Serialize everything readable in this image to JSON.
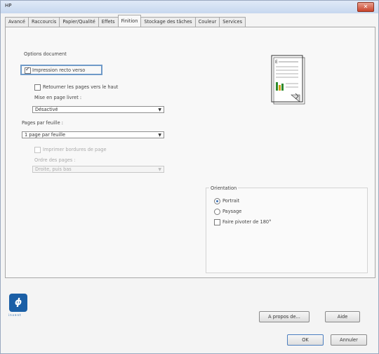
{
  "window": {
    "title": "HP",
    "close_glyph": "✕"
  },
  "tabs": [
    "Avancé",
    "Raccourcis",
    "Papier/Qualité",
    "Effets",
    "Finition",
    "Stockage des tâches",
    "Couleur",
    "Services"
  ],
  "finishing": {
    "document_options_label": "Options document",
    "duplex_label": "Impression recto verso",
    "flip_pages_label": "Retourner les pages vers le haut",
    "booklet_layout_label": "Mise en page livret :",
    "booklet_layout_value": "Désactivé",
    "pages_per_sheet_label": "Pages par feuille :",
    "pages_per_sheet_value": "1 page par feuille",
    "print_borders_label": "Imprimer bordures de page",
    "page_order_label": "Ordre des pages :",
    "page_order_value": "Droite, puis bas"
  },
  "orientation": {
    "label": "Orientation",
    "portrait_label": "Portrait",
    "landscape_label": "Paysage",
    "rotate_label": "Faire pivoter de 180°"
  },
  "brand": {
    "logo_letters": "ϕ",
    "logo_text": "invent"
  },
  "buttons": {
    "about": "A propos de...",
    "help": "Aide",
    "ok": "OK",
    "cancel": "Annuler"
  }
}
